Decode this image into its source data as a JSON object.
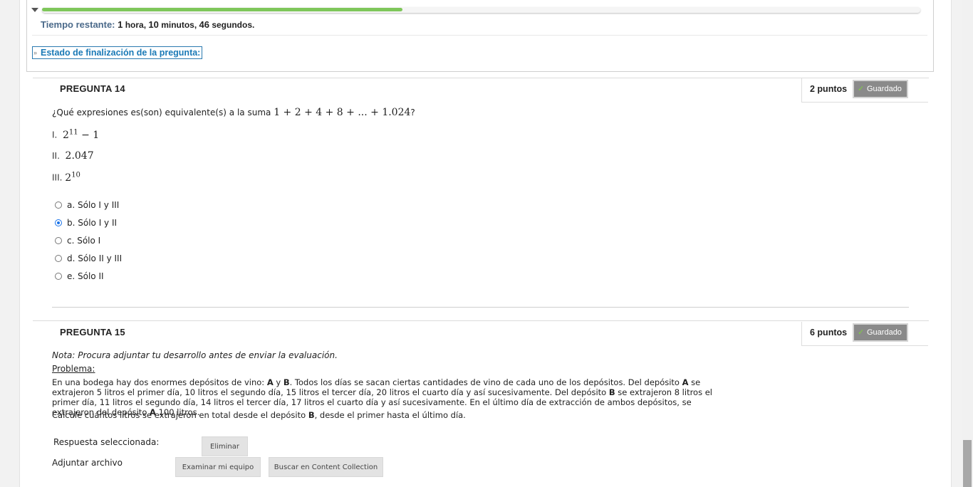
{
  "timer": {
    "label": "Tiempo restante:",
    "value_html_parts": {
      "hours": "1",
      "hours_unit": " hora, ",
      "minutes": "10",
      "minutes_unit": " minutos, ",
      "seconds": "46",
      "seconds_unit": " segundos."
    },
    "progress_fraction": 0.41
  },
  "completion_status": {
    "label": "Estado de finalización de la pregunta:"
  },
  "q14": {
    "title": "PREGUNTA 14",
    "points": "2 puntos",
    "saved": "Guardado",
    "prompt": "¿Qué expresiones es(son) equivalente(s) a la suma ",
    "sum": "1 + 2 + 4 + 8 + ... + 1.024",
    "prompt_end": "?",
    "statements": [
      {
        "num": "I.",
        "base": "2",
        "exp": "11",
        "rest": " − 1"
      },
      {
        "num": "II.",
        "base": "2.047",
        "exp": "",
        "rest": ""
      },
      {
        "num": "III.",
        "base": "2",
        "exp": "10",
        "rest": ""
      }
    ],
    "options": [
      {
        "label": "a. Sólo I y III",
        "selected": false
      },
      {
        "label": "b. Sólo I y II",
        "selected": true
      },
      {
        "label": "c. Sólo I",
        "selected": false
      },
      {
        "label": "d. Sólo II y III",
        "selected": false
      },
      {
        "label": "e. Sólo II",
        "selected": false
      }
    ]
  },
  "q15": {
    "title": "PREGUNTA 15",
    "points": "6 puntos",
    "saved": "Guardado",
    "note": "Nota: Procura adjuntar tu desarrollo antes de enviar la evaluación.",
    "problem_label": "Problema",
    "problem_label_suffix": ":",
    "paragraph_parts": [
      "En una bodega hay dos enormes depósitos de vino: ",
      "A",
      " y ",
      "B",
      ". Todos los días se sacan ciertas cantidades de vino de cada uno de los depósitos. Del depósito ",
      "A",
      " se extrajeron 5 litros el primer día, 10 litros el segundo día, 15 litros el tercer día, 20 litros el cuarto día y así sucesivamente. Del depósito ",
      "B",
      " se extrajeron 8 litros el primer día, 11 litros el segundo día, 14 litros el tercer día, 17 litros el cuarto día y así sucesivamente. En el último día de extracción de ambos depósitos, se extrajeron del depósito ",
      "A",
      " 100 litros."
    ],
    "question_parts": [
      "Calcule cuántos litros se extrajeron en total desde el depósito ",
      "B",
      ", desde el primer hasta el último día."
    ],
    "selected_answer_label": "Respuesta seleccionada:",
    "remove_button": "Eliminar",
    "attach_label": "Adjuntar archivo",
    "browse_button": "Examinar mi equipo",
    "content_collection_button": "Buscar en Content Collection"
  }
}
